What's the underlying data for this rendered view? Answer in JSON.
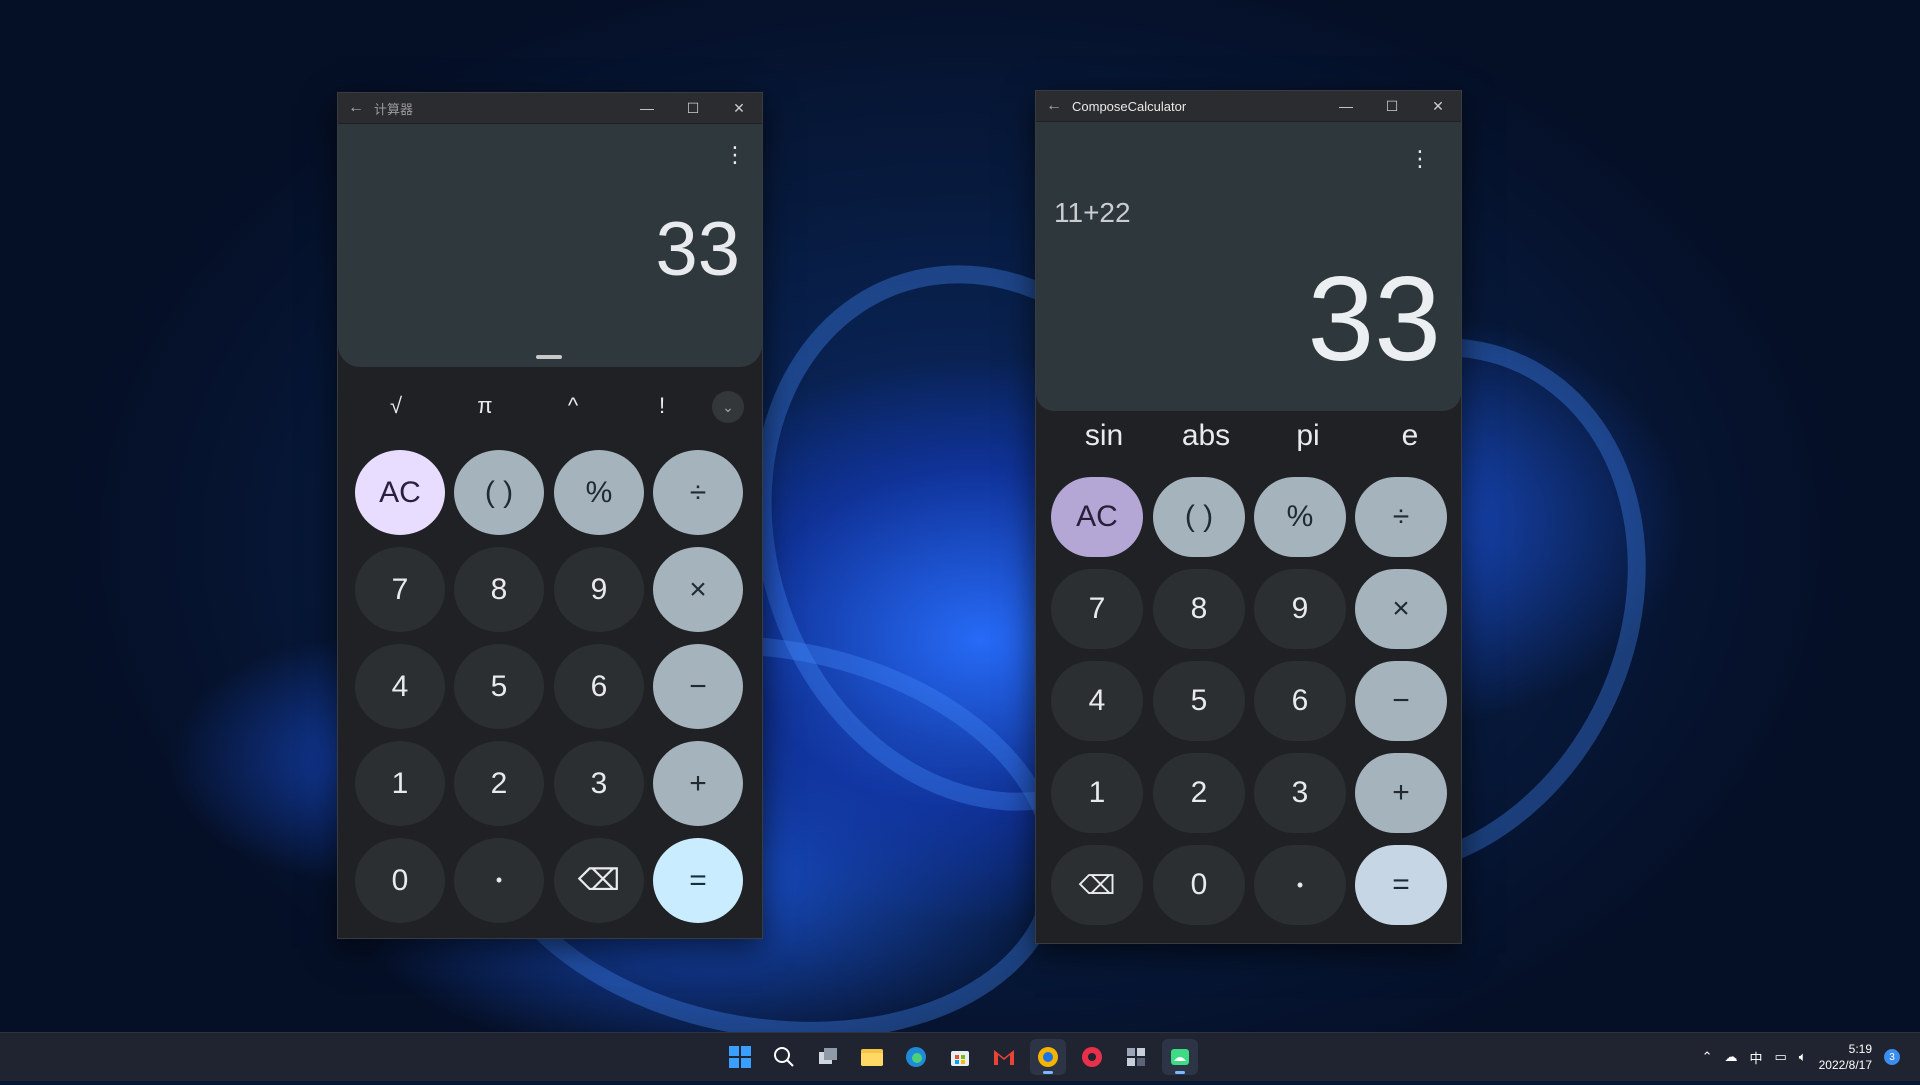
{
  "window_left": {
    "title": "计算器",
    "result": "33",
    "scientific_keys": [
      "√",
      "π",
      "^",
      "!"
    ],
    "keys": [
      [
        "AC",
        "( )",
        "%",
        "÷"
      ],
      [
        "7",
        "8",
        "9",
        "×"
      ],
      [
        "4",
        "5",
        "6",
        "−"
      ],
      [
        "1",
        "2",
        "3",
        "+"
      ],
      [
        "0",
        "•",
        "⌫",
        "="
      ]
    ]
  },
  "window_right": {
    "title": "ComposeCalculator",
    "expression": "11+22",
    "result": "33",
    "scientific_keys": [
      "sin",
      "abs",
      "pi",
      "e"
    ],
    "keys": [
      [
        "AC",
        "( )",
        "%",
        "÷"
      ],
      [
        "7",
        "8",
        "9",
        "×"
      ],
      [
        "4",
        "5",
        "6",
        "−"
      ],
      [
        "1",
        "2",
        "3",
        "+"
      ],
      [
        "⌫",
        "0",
        "•",
        "="
      ]
    ]
  },
  "taskbar": {
    "icons": [
      "windows-start-icon",
      "search-icon",
      "task-view-icon",
      "file-explorer-icon",
      "edge-icon",
      "store-icon",
      "gmail-icon",
      "app-icon",
      "music-icon",
      "calculator-icon",
      "android-icon"
    ],
    "tray": {
      "ime": "中",
      "time": "5:19",
      "date": "2022/8/17",
      "notifications": "3"
    }
  },
  "colors": {
    "ac_left": "#e9ddff",
    "ac_right": "#b4a7d6",
    "func": "#a5b3bd",
    "equals_left": "#c9ecff",
    "equals_right": "#c6d6e4"
  }
}
